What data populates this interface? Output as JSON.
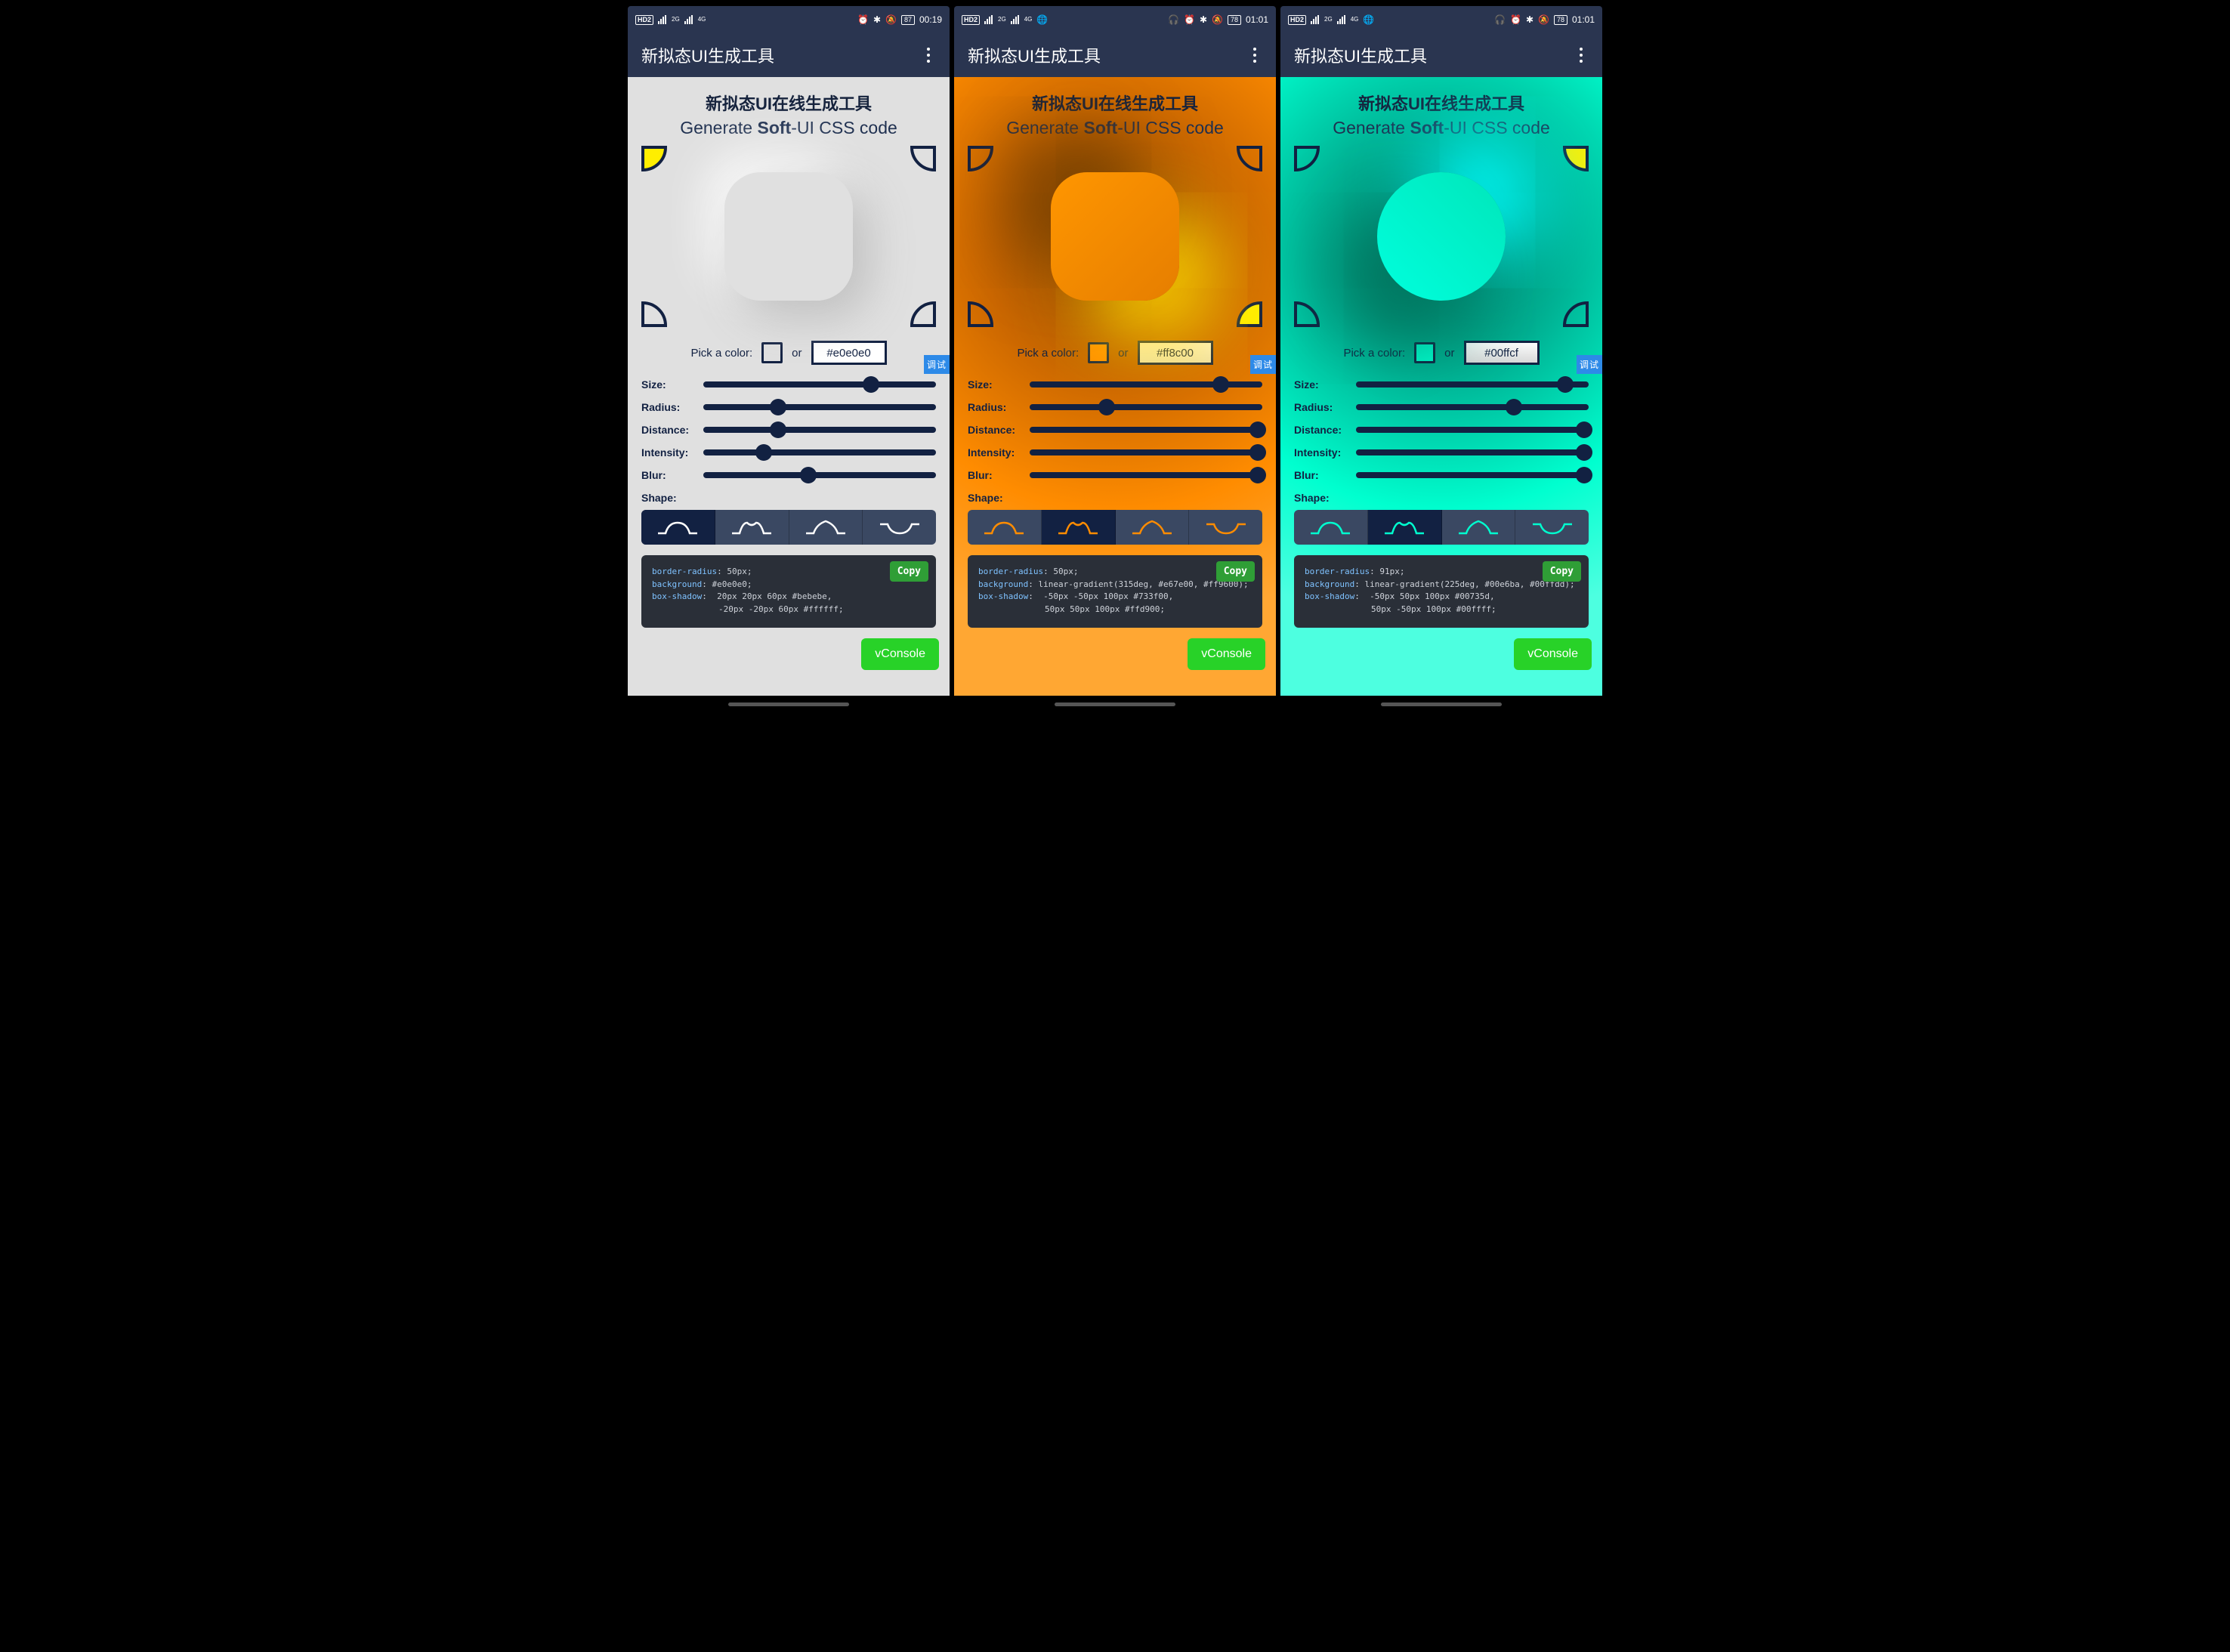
{
  "variants": [
    {
      "status": {
        "hd": "HD2",
        "net1": "2G",
        "net2": "4G",
        "icons": [
          "alarm",
          "bt",
          "mute"
        ],
        "battery": "87",
        "time": "00:19",
        "hasHeadphones": false,
        "hasGlobe": false
      },
      "appbar": {
        "title": "新拟态UI生成工具"
      },
      "heading1": "新拟态UI在线生成工具",
      "heading2_prefix": "Generate ",
      "heading2_bold": "Soft",
      "heading2_suffix": "-UI CSS code",
      "color": {
        "pick_label": "Pick a color:",
        "or_label": "or",
        "hex": "#e0e0e0"
      },
      "debug_label": "调试",
      "sliders": {
        "size": {
          "label": "Size:",
          "pct": 72
        },
        "radius": {
          "label": "Radius:",
          "pct": 32
        },
        "distance": {
          "label": "Distance:",
          "pct": 32
        },
        "intensity": {
          "label": "Intensity:",
          "pct": 26
        },
        "blur": {
          "label": "Blur:",
          "pct": 45
        }
      },
      "shape_label": "Shape:",
      "shape_selected": 0,
      "active_corner": "tl",
      "copy_label": "Copy",
      "code": {
        "line1_k": "border-radius",
        "line1_v": "50px;",
        "line2_k": "background",
        "line2_v": "#e0e0e0;",
        "line3_k": "box-shadow",
        "line3_v": "20px 20px 60px #bebebe,",
        "line4_v": "-20px -20px 60px #ffffff;"
      },
      "vconsole": "vConsole"
    },
    {
      "status": {
        "hd": "HD2",
        "net1": "2G",
        "net2": "4G",
        "icons": [
          "headphones",
          "alarm",
          "bt",
          "mute"
        ],
        "battery": "78",
        "time": "01:01",
        "hasHeadphones": true,
        "hasGlobe": true
      },
      "appbar": {
        "title": "新拟态UI生成工具"
      },
      "heading1": "新拟态UI在线生成工具",
      "heading2_prefix": "Generate ",
      "heading2_bold": "Soft",
      "heading2_suffix": "-UI CSS code",
      "color": {
        "pick_label": "Pick a color:",
        "or_label": "or",
        "hex": "#ff8c00"
      },
      "debug_label": "调试",
      "sliders": {
        "size": {
          "label": "Size:",
          "pct": 82
        },
        "radius": {
          "label": "Radius:",
          "pct": 33
        },
        "distance": {
          "label": "Distance:",
          "pct": 98
        },
        "intensity": {
          "label": "Intensity:",
          "pct": 98
        },
        "blur": {
          "label": "Blur:",
          "pct": 98
        }
      },
      "shape_label": "Shape:",
      "shape_selected": 1,
      "active_corner": "br",
      "copy_label": "Copy",
      "code": {
        "line1_k": "border-radius",
        "line1_v": "50px;",
        "line2_k": "background",
        "line2_v": "linear-gradient(315deg, #e67e00, #ff9600);",
        "line3_k": "box-shadow",
        "line3_v": "-50px -50px 100px #733f00,",
        "line4_v": "50px 50px 100px #ffd900;"
      },
      "vconsole": "vConsole"
    },
    {
      "status": {
        "hd": "HD2",
        "net1": "2G",
        "net2": "4G",
        "icons": [
          "headphones",
          "alarm",
          "bt",
          "mute"
        ],
        "battery": "78",
        "time": "01:01",
        "hasHeadphones": true,
        "hasGlobe": true
      },
      "appbar": {
        "title": "新拟态UI生成工具"
      },
      "heading1": "新拟态UI在线生成工具",
      "heading2_prefix": "Generate ",
      "heading2_bold": "Soft",
      "heading2_suffix": "-UI CSS code",
      "color": {
        "pick_label": "Pick a color:",
        "or_label": "or",
        "hex": "#00ffcf"
      },
      "debug_label": "调试",
      "sliders": {
        "size": {
          "label": "Size:",
          "pct": 90
        },
        "radius": {
          "label": "Radius:",
          "pct": 68
        },
        "distance": {
          "label": "Distance:",
          "pct": 98
        },
        "intensity": {
          "label": "Intensity:",
          "pct": 98
        },
        "blur": {
          "label": "Blur:",
          "pct": 98
        }
      },
      "shape_label": "Shape:",
      "shape_selected": 1,
      "active_corner": "tr",
      "copy_label": "Copy",
      "code": {
        "line1_k": "border-radius",
        "line1_v": "91px;",
        "line2_k": "background",
        "line2_v": "linear-gradient(225deg, #00e6ba, #00ffdd);",
        "line3_k": "box-shadow",
        "line3_v": "-50px 50px 100px #00735d,",
        "line4_v": "50px -50px 100px #00ffff;"
      },
      "vconsole": "vConsole"
    }
  ]
}
